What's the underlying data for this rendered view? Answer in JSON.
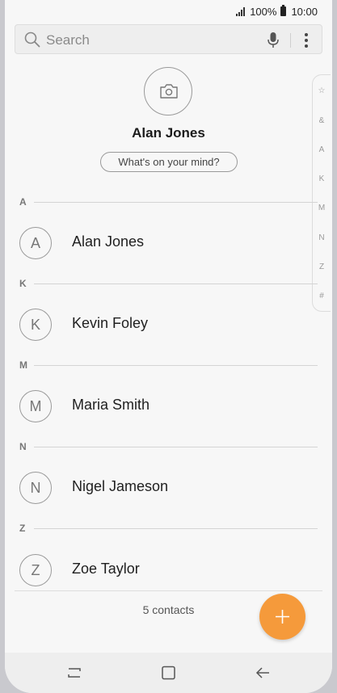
{
  "status_bar": {
    "battery": "100%",
    "time": "10:00"
  },
  "search": {
    "placeholder": "Search",
    "icons": [
      "search-icon",
      "mic-icon",
      "more-icon"
    ]
  },
  "profile": {
    "name": "Alan Jones",
    "status_prompt": "What's on your mind?",
    "photo_icon": "camera-icon"
  },
  "index_scroller": [
    "☆",
    "&",
    "A",
    "K",
    "M",
    "N",
    "Z",
    "#"
  ],
  "sections": [
    {
      "letter": "A",
      "contacts": [
        {
          "initial": "A",
          "name": "Alan Jones"
        }
      ]
    },
    {
      "letter": "K",
      "contacts": [
        {
          "initial": "K",
          "name": "Kevin Foley"
        }
      ]
    },
    {
      "letter": "M",
      "contacts": [
        {
          "initial": "M",
          "name": "Maria Smith"
        }
      ]
    },
    {
      "letter": "N",
      "contacts": [
        {
          "initial": "N",
          "name": "Nigel Jameson"
        }
      ]
    },
    {
      "letter": "Z",
      "contacts": [
        {
          "initial": "Z",
          "name": "Zoe Taylor"
        }
      ]
    }
  ],
  "footer": {
    "count_label": "5 contacts"
  },
  "fab": {
    "icon": "plus-icon"
  },
  "nav_bar": {
    "icons": [
      "recent-apps-icon",
      "home-icon",
      "back-icon"
    ]
  },
  "colors": {
    "accent": "#f59a3b",
    "background": "#f7f7f7"
  }
}
